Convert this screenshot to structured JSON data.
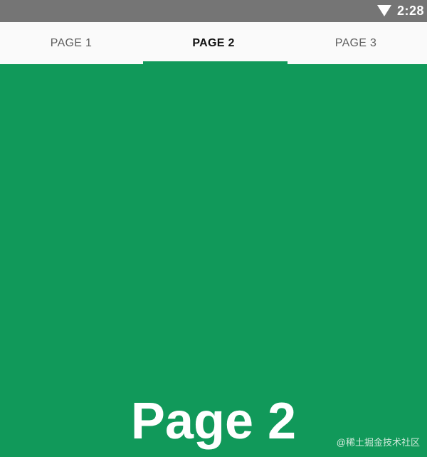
{
  "status_bar": {
    "time": "2:28",
    "wifi_icon": "wifi-icon"
  },
  "tabs": [
    {
      "label": "PAGE 1",
      "active": false
    },
    {
      "label": "PAGE 2",
      "active": true
    },
    {
      "label": "PAGE 3",
      "active": false
    }
  ],
  "content": {
    "heading": "Page 2",
    "background_color": "#11995a"
  },
  "watermark": "@稀土掘金技术社区",
  "colors": {
    "accent": "#11995a",
    "status_bar": "#757575",
    "tab_bar": "#fafafa"
  }
}
